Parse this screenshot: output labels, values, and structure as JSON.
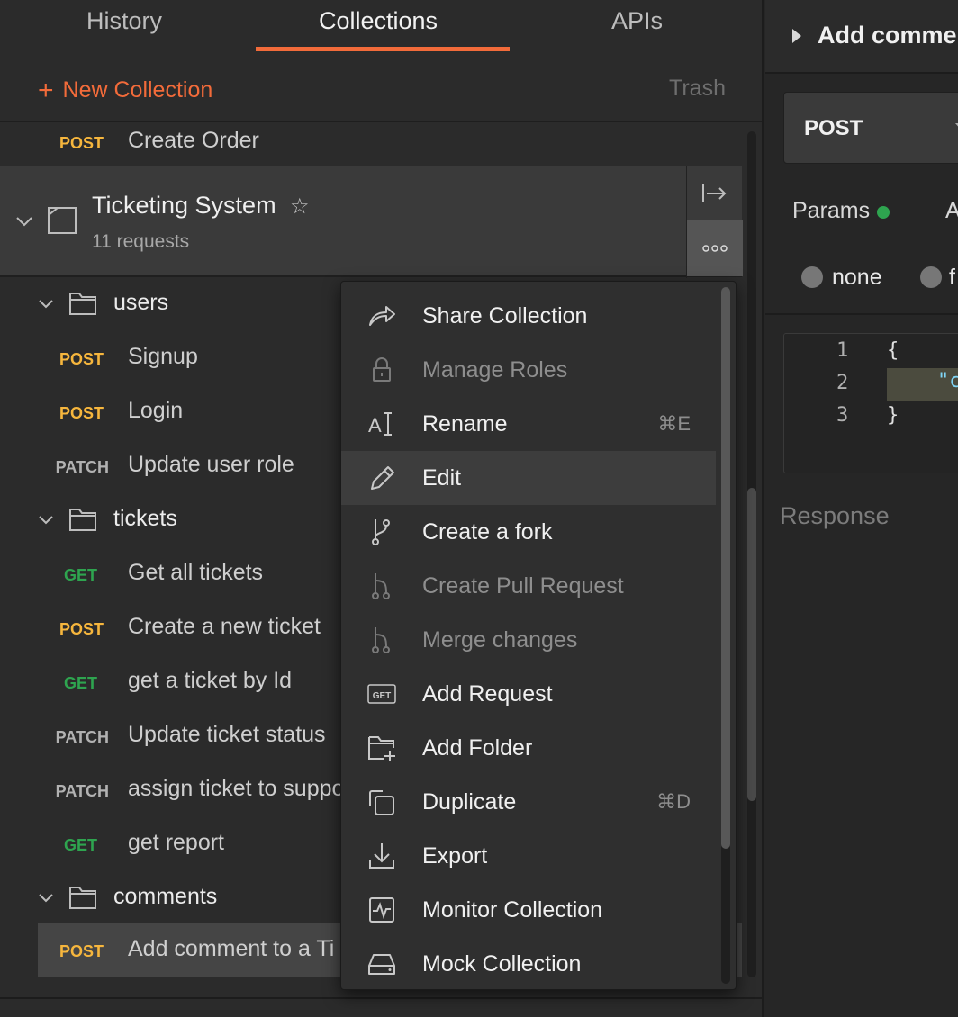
{
  "sidebar": {
    "tabs": [
      {
        "label": "History"
      },
      {
        "label": "Collections"
      },
      {
        "label": "APIs"
      }
    ],
    "new_collection_label": "New Collection",
    "trash_label": "Trash",
    "top_request": {
      "method": "POST",
      "name": "Create Order"
    },
    "collection": {
      "title": "Ticketing System",
      "subtitle": "11 requests"
    },
    "folders": [
      {
        "name": "users"
      },
      {
        "name": "tickets"
      },
      {
        "name": "comments"
      }
    ],
    "requests": [
      {
        "method": "POST",
        "name": "Signup"
      },
      {
        "method": "POST",
        "name": "Login"
      },
      {
        "method": "PATCH",
        "name": "Update user role"
      },
      {
        "method": "GET",
        "name": "Get all tickets"
      },
      {
        "method": "POST",
        "name": "Create a new ticket"
      },
      {
        "method": "GET",
        "name": "get a ticket by Id"
      },
      {
        "method": "PATCH",
        "name": "Update ticket status"
      },
      {
        "method": "PATCH",
        "name": "assign ticket to suppo"
      },
      {
        "method": "GET",
        "name": "get report"
      },
      {
        "method": "POST",
        "name": "Add comment to a Ti"
      }
    ]
  },
  "menu": {
    "items": [
      {
        "label": "Share Collection",
        "icon": "share-icon",
        "shortcut": ""
      },
      {
        "label": "Manage Roles",
        "icon": "lock-icon",
        "shortcut": ""
      },
      {
        "label": "Rename",
        "icon": "rename-icon",
        "shortcut": "⌘E"
      },
      {
        "label": "Edit",
        "icon": "pencil-icon",
        "shortcut": ""
      },
      {
        "label": "Create a fork",
        "icon": "fork-icon",
        "shortcut": ""
      },
      {
        "label": "Create Pull Request",
        "icon": "pull-request-icon",
        "shortcut": ""
      },
      {
        "label": "Merge changes",
        "icon": "merge-icon",
        "shortcut": ""
      },
      {
        "label": "Add Request",
        "icon": "get-request-icon",
        "shortcut": ""
      },
      {
        "label": "Add Folder",
        "icon": "add-folder-icon",
        "shortcut": ""
      },
      {
        "label": "Duplicate",
        "icon": "duplicate-icon",
        "shortcut": "⌘D"
      },
      {
        "label": "Export",
        "icon": "export-icon",
        "shortcut": ""
      },
      {
        "label": "Monitor Collection",
        "icon": "monitor-icon",
        "shortcut": ""
      },
      {
        "label": "Mock Collection",
        "icon": "mock-icon",
        "shortcut": ""
      }
    ],
    "get_badge": "GET"
  },
  "right": {
    "request_tab_title": "Add commer",
    "method": "POST",
    "params_label": "Params",
    "auth_tab_partial": "A",
    "body_options": [
      {
        "label": "none"
      },
      {
        "label": "f"
      }
    ],
    "editor": {
      "lines": [
        "1",
        "2",
        "3"
      ],
      "open_brace": "{",
      "string_partial": "\"c",
      "close_brace": "}"
    },
    "response_label": "Response"
  },
  "colors": {
    "accent": "#f26b3a",
    "post": "#f6b63d",
    "get": "#2ea44f",
    "patch": "#b2b2b2"
  }
}
